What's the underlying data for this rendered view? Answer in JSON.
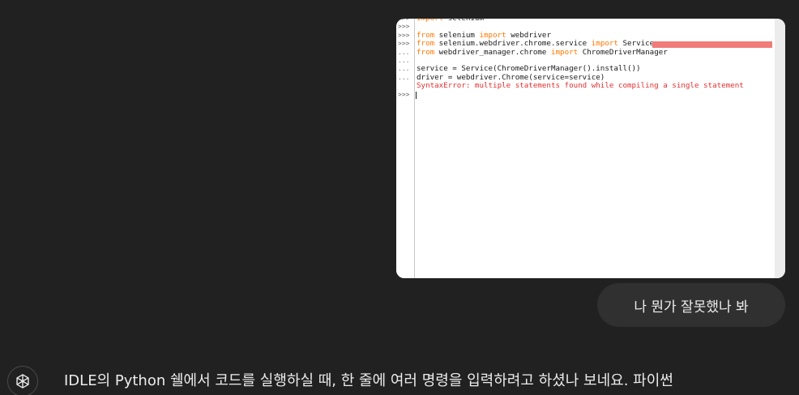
{
  "screenshot": {
    "lines": [
      {
        "prompt": ">>>",
        "parts": [
          {
            "t": "import",
            "c": "kw"
          },
          {
            "t": " selenium",
            "c": ""
          }
        ]
      },
      {
        "prompt": ">>>",
        "parts": []
      },
      {
        "prompt": ">>>",
        "parts": [
          {
            "t": "from",
            "c": "kw"
          },
          {
            "t": " selenium ",
            "c": ""
          },
          {
            "t": "import",
            "c": "kw"
          },
          {
            "t": " webdriver",
            "c": ""
          }
        ]
      },
      {
        "prompt": ">>>",
        "parts": [
          {
            "t": "from",
            "c": "kw"
          },
          {
            "t": " selenium.webdriver.chrome.service ",
            "c": ""
          },
          {
            "t": "import",
            "c": "kw"
          },
          {
            "t": " Service",
            "c": ""
          }
        ],
        "redacted": true
      },
      {
        "prompt": "...",
        "parts": [
          {
            "t": "from",
            "c": "kw"
          },
          {
            "t": " webdriver_manager.chrome ",
            "c": ""
          },
          {
            "t": "import",
            "c": "kw"
          },
          {
            "t": " ChromeDriverManager",
            "c": ""
          }
        ]
      },
      {
        "prompt": "...",
        "parts": []
      },
      {
        "prompt": "...",
        "parts": [
          {
            "t": "service = Service(ChromeDriverManager().install())",
            "c": ""
          }
        ]
      },
      {
        "prompt": "...",
        "parts": [
          {
            "t": "driver = webdriver.Chrome(service=service)",
            "c": ""
          }
        ]
      },
      {
        "prompt": "",
        "parts": [
          {
            "t": "SyntaxError: multiple statements found while compiling a single statement",
            "c": "err"
          }
        ]
      },
      {
        "prompt": ">>>",
        "parts": [],
        "cursor": true
      }
    ]
  },
  "user_message": "나 뭔가 잘못했나 봐",
  "assistant_message": "IDLE의 Python 쉘에서 코드를 실행하실 때, 한 줄에 여러 명령을 입력하려고 하셨나 보네요. 파이썬",
  "avatar_icon": "openai-logo-icon"
}
